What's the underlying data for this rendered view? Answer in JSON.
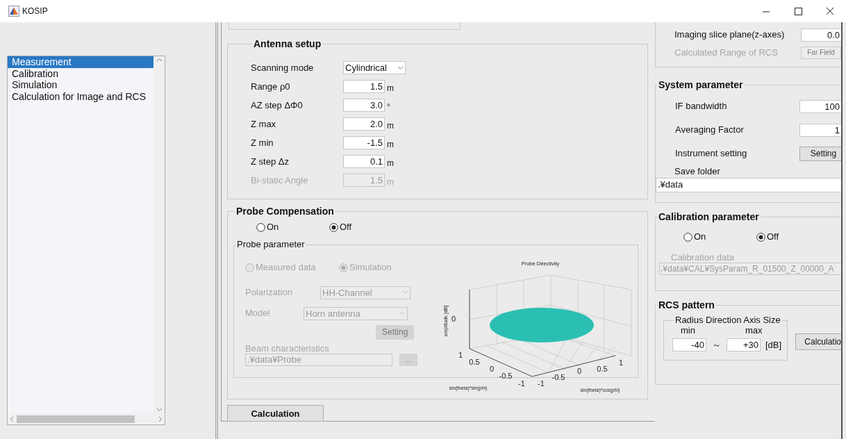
{
  "window": {
    "title": "KOSIP"
  },
  "sidebar": {
    "items": [
      {
        "label": "Measurement",
        "selected": true
      },
      {
        "label": "Calibration",
        "selected": false
      },
      {
        "label": "Simulation",
        "selected": false
      },
      {
        "label": "Calculation for Image and RCS",
        "selected": false
      }
    ]
  },
  "antenna_setup": {
    "title": "Antenna setup",
    "fields": [
      {
        "kind": "select",
        "label": "Scanning mode",
        "value": "Cylindrical",
        "disabled": false
      },
      {
        "kind": "number",
        "label": "Range ρ0",
        "value": "1.5",
        "unit": "m",
        "disabled": false
      },
      {
        "kind": "number",
        "label": "AZ step ΔΦ0",
        "value": "3.0",
        "unit": "°",
        "disabled": false
      },
      {
        "kind": "number",
        "label": "Z max",
        "value": "2.0",
        "unit": "m",
        "disabled": false
      },
      {
        "kind": "number",
        "label": "Z min",
        "value": "-1.5",
        "unit": "m",
        "disabled": false
      },
      {
        "kind": "number",
        "label": "Z step Δz",
        "value": "0.1",
        "unit": "m",
        "disabled": false
      },
      {
        "kind": "number",
        "label": "Bi-static Angle",
        "value": "1.5",
        "unit": "m",
        "disabled": true
      }
    ]
  },
  "probe_compensation": {
    "title": "Probe Compensation",
    "options": [
      {
        "label": "On",
        "selected": false
      },
      {
        "label": "Off",
        "selected": true
      }
    ],
    "probe_parameter": {
      "title": "Probe parameter",
      "disabled": true,
      "source_options": [
        {
          "label": "Measured data",
          "selected": false
        },
        {
          "label": "Simulation",
          "selected": true
        }
      ],
      "polarization": {
        "label": "Polarization",
        "value": "HH-Channel"
      },
      "model": {
        "label": "Model",
        "value": "Horn antenna"
      },
      "setting_button": "Setting",
      "beam": {
        "label": "Beam characteristics",
        "value": ".¥data¥Probe",
        "browse_button": "..."
      },
      "plot": {
        "title": "Probe Directivity",
        "zlabel": "amplitude [dB]",
        "xlabel": "sin(theta)*cos(phi)",
        "ylabel": "sin(theta)*sin(phi)",
        "zticks": [
          "0"
        ],
        "xticks": [
          "-1",
          "-0.5",
          "0",
          "0.5",
          "1"
        ],
        "yticks": [
          "1",
          "0.5",
          "0",
          "-0.5",
          "-1"
        ]
      }
    }
  },
  "calculation_button": "Calculation",
  "imaging": {
    "fields": [
      {
        "kind": "number",
        "label": "Imaging slice plane(z-axes)",
        "value": "0.0",
        "disabled": false
      },
      {
        "kind": "button",
        "label": "Calculated Range of RCS",
        "value": "Far Field",
        "disabled": true
      }
    ]
  },
  "system_parameter": {
    "title": "System parameter",
    "fields": [
      {
        "kind": "number",
        "label": "IF bandwidth",
        "value": "100"
      },
      {
        "kind": "number",
        "label": "Averaging Factor",
        "value": "1"
      },
      {
        "kind": "button",
        "label": "Instrument setting",
        "value": "Setting"
      },
      {
        "kind": "path",
        "label": "Save folder",
        "value": ".¥data"
      }
    ]
  },
  "calibration_parameter": {
    "title": "Calibration parameter",
    "options": [
      {
        "label": "On",
        "selected": false
      },
      {
        "label": "Off",
        "selected": true
      }
    ],
    "data": {
      "label": "Calibration data",
      "value": ".¥data¥CAL¥SysParam_R_01500_Z_00000_A",
      "disabled": true
    }
  },
  "rcs_pattern": {
    "title": "RCS pattern",
    "axis_size": {
      "title": "Radius Direction Axis Size",
      "min_label": "min",
      "max_label": "max",
      "min_value": "-40",
      "separator": "～",
      "max_value": "+30",
      "unit": "[dB]"
    },
    "calculation_button": "Calculatio"
  }
}
